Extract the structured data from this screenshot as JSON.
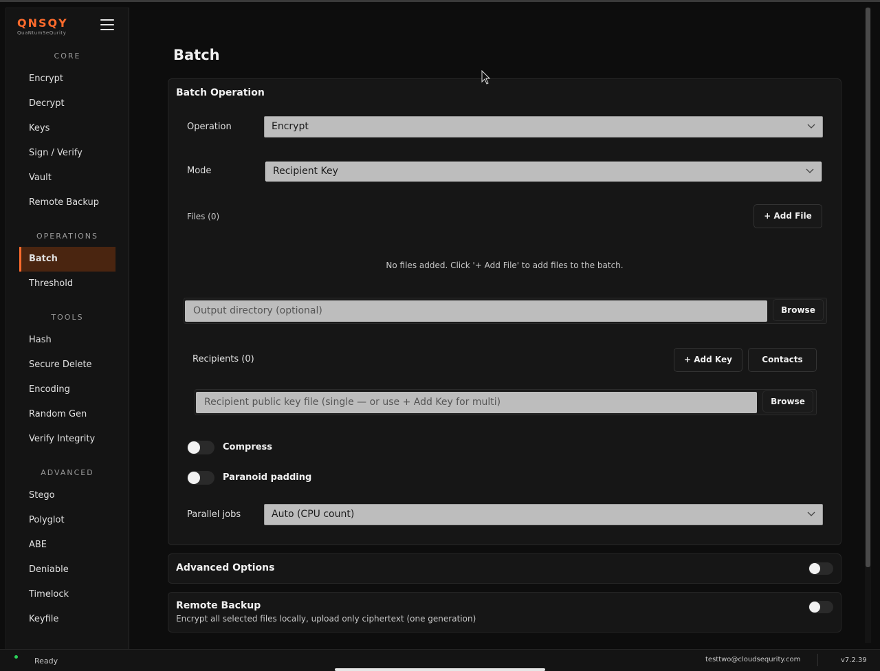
{
  "logo": {
    "main": "QNSQY",
    "sub": "QuaNtumSeQurity"
  },
  "sidebar": {
    "sections": {
      "core": "CORE",
      "operations": "OPERATIONS",
      "tools": "TOOLS",
      "advanced": "ADVANCED"
    },
    "core_items": [
      "Encrypt",
      "Decrypt",
      "Keys",
      "Sign / Verify",
      "Vault",
      "Remote Backup"
    ],
    "operations_items": [
      "Batch",
      "Threshold"
    ],
    "tools_items": [
      "Hash",
      "Secure Delete",
      "Encoding",
      "Random Gen",
      "Verify Integrity"
    ],
    "advanced_items": [
      "Stego",
      "Polyglot",
      "ABE",
      "Deniable",
      "Timelock",
      "Keyfile"
    ],
    "active": "Batch"
  },
  "page": {
    "title": "Batch"
  },
  "batch": {
    "panel_title": "Batch Operation",
    "operation_label": "Operation",
    "operation_value": "Encrypt",
    "mode_label": "Mode",
    "mode_value": "Recipient Key",
    "files_label": "Files (0)",
    "add_file_label": "+ Add File",
    "empty_message": "No files added. Click '+ Add File' to add files to the batch.",
    "output_placeholder": "Output directory (optional)",
    "browse_label": "Browse",
    "recipients_label": "Recipients (0)",
    "add_key_label": "+ Add Key",
    "contacts_label": "Contacts",
    "recipient_placeholder": "Recipient public key file (single — or use + Add Key for multi)",
    "compress_label": "Compress",
    "compress_on": false,
    "paranoid_label": "Paranoid padding",
    "paranoid_on": false,
    "parallel_label": "Parallel jobs",
    "parallel_value": "Auto (CPU count)"
  },
  "advanced_options": {
    "title": "Advanced Options",
    "enabled": false
  },
  "remote_backup": {
    "title": "Remote Backup",
    "description": "Encrypt all selected files locally, upload only ciphertext (one generation)",
    "enabled": false
  },
  "status": {
    "text": "Ready",
    "user": "testtwo@cloudsequrity.com",
    "version": "v7.2.39"
  },
  "colors": {
    "accent": "#ff6b2c",
    "active_bg": "#4a2510",
    "status_ok": "#2bd45a"
  }
}
